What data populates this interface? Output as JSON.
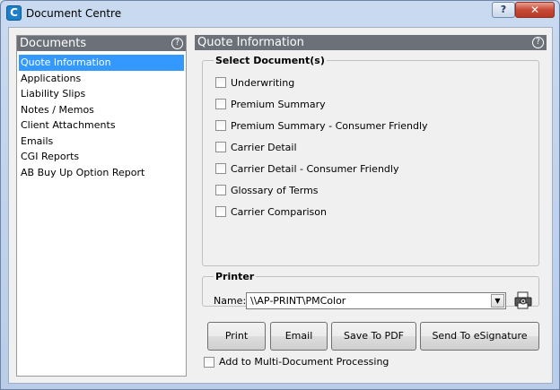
{
  "window": {
    "title": "Document Centre",
    "icon_glyph": "C",
    "help_glyph": "?",
    "close_glyph": "✕"
  },
  "left_panel": {
    "header": "Documents",
    "help_glyph": "?",
    "items": [
      {
        "label": "Quote Information",
        "selected": true
      },
      {
        "label": "Applications"
      },
      {
        "label": "Liability Slips"
      },
      {
        "label": "Notes / Memos"
      },
      {
        "label": "Client Attachments"
      },
      {
        "label": "Emails"
      },
      {
        "label": "CGI Reports"
      },
      {
        "label": "AB Buy Up Option Report"
      }
    ]
  },
  "right_panel": {
    "header": "Quote Information",
    "help_glyph": "?",
    "select_documents": {
      "legend": "Select Document(s)",
      "options": [
        {
          "label": "Underwriting",
          "checked": false
        },
        {
          "label": "Premium Summary",
          "checked": false
        },
        {
          "label": "Premium Summary - Consumer Friendly",
          "checked": false
        },
        {
          "label": "Carrier Detail",
          "checked": false
        },
        {
          "label": "Carrier Detail - Consumer Friendly",
          "checked": false
        },
        {
          "label": "Glossary of Terms",
          "checked": false
        },
        {
          "label": "Carrier Comparison",
          "checked": false
        }
      ]
    },
    "printer": {
      "legend": "Printer",
      "name_label": "Name:",
      "selected": "\\\\AP-PRINT\\PMColor",
      "dropdown_glyph": "▼"
    },
    "buttons": {
      "print": "Print",
      "email": "Email",
      "save_pdf": "Save To PDF",
      "esign": "Send To eSignature"
    },
    "multi_doc": {
      "label": "Add to Multi-Document Processing",
      "checked": false
    }
  },
  "colors": {
    "selection": "#3399ff",
    "panel_header": "#6b7079",
    "close_button": "#c74a36"
  }
}
